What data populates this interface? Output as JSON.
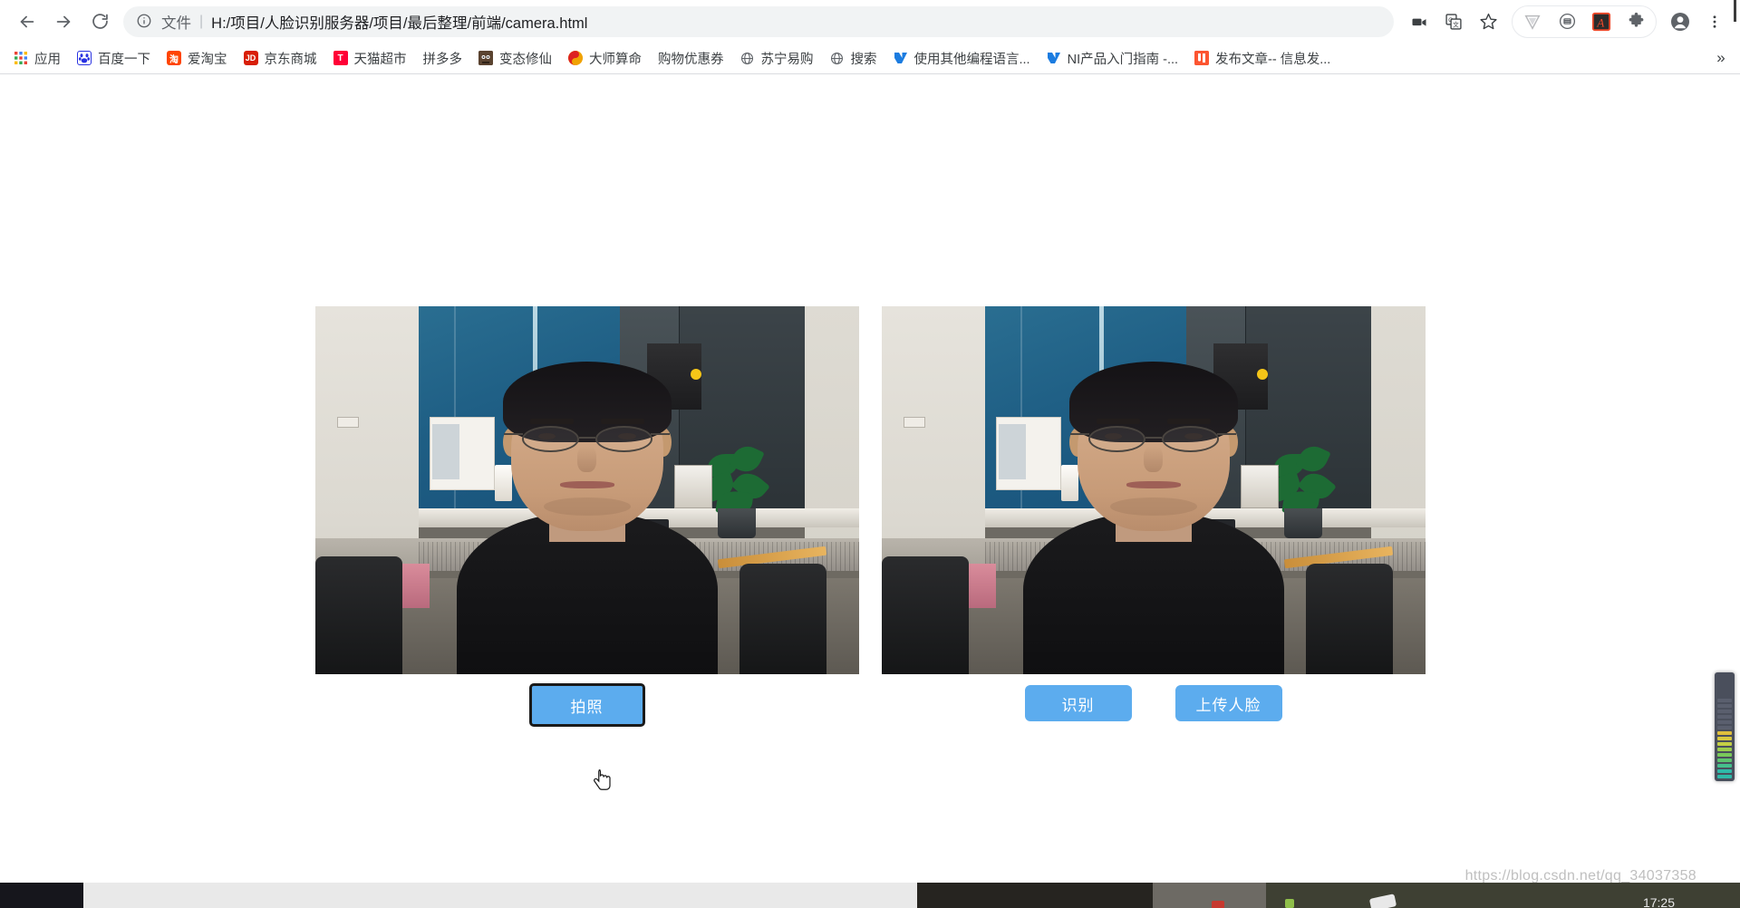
{
  "browser": {
    "nav": {
      "back_label": "Back",
      "forward_label": "Forward",
      "reload_label": "Reload"
    },
    "omnibox": {
      "info_icon": "info-circle-icon",
      "scheme_label": "文件",
      "separator": "|",
      "url": "H:/项目/人脸识别服务器/项目/最后整理/前端/camera.html"
    },
    "toolbar_icons": [
      {
        "name": "video-camera-icon",
        "glyph": "camera"
      },
      {
        "name": "google-translate-icon",
        "glyph": "translate"
      },
      {
        "name": "bookmark-star-icon",
        "glyph": "star"
      }
    ],
    "extension_icons": [
      {
        "name": "vimium-extension-icon",
        "glyph": "V"
      },
      {
        "name": "badge-extension-icon",
        "glyph": "circle"
      },
      {
        "name": "adobe-acrobat-extension-icon",
        "glyph": "A"
      },
      {
        "name": "extensions-puzzle-icon",
        "glyph": "puzzle"
      }
    ],
    "profile_icon": "profile-avatar-icon",
    "menu_icon": "three-dot-menu-icon",
    "bookmarks_overflow_label": "»"
  },
  "bookmarks": [
    {
      "label": "应用",
      "icon": "apps-grid-icon",
      "icon_class": "ic-apps",
      "icon_text": ""
    },
    {
      "label": "百度一下",
      "icon": "baidu-icon",
      "icon_class": "ic-baidu",
      "icon_text": ""
    },
    {
      "label": "爱淘宝",
      "icon": "taobao-icon",
      "icon_class": "ic-taobao",
      "icon_text": "淘"
    },
    {
      "label": "京东商城",
      "icon": "jd-icon",
      "icon_class": "ic-jd",
      "icon_text": "JD"
    },
    {
      "label": "天猫超市",
      "icon": "tmall-icon",
      "icon_class": "ic-tmall",
      "icon_text": "T"
    },
    {
      "label": "拼多多",
      "icon": "pinduoduo-icon",
      "icon_class": "ic-pdd",
      "icon_text": ""
    },
    {
      "label": "变态修仙",
      "icon": "game-avatar-icon",
      "icon_class": "ic-btxx",
      "icon_text": ""
    },
    {
      "label": "大师算命",
      "icon": "taiji-icon",
      "icon_class": "ic-dsm",
      "icon_text": ""
    },
    {
      "label": "购物优惠券",
      "icon": "coupon-icon",
      "icon_class": "ic-gwyhq",
      "icon_text": ""
    },
    {
      "label": "苏宁易购",
      "icon": "globe-icon",
      "icon_class": "ic-globe",
      "icon_text": ""
    },
    {
      "label": "搜索",
      "icon": "globe-icon",
      "icon_class": "ic-globe",
      "icon_text": ""
    },
    {
      "label": "使用其他编程语言...",
      "icon": "ni-icon",
      "icon_class": "ic-ni",
      "icon_text": ""
    },
    {
      "label": "NI产品入门指南 -...",
      "icon": "ni-icon",
      "icon_class": "ic-ni",
      "icon_text": ""
    },
    {
      "label": "发布文章-- 信息发...",
      "icon": "csdn-icon",
      "icon_class": "ic-csdn",
      "icon_text": ""
    }
  ],
  "page": {
    "left_panel": {
      "name": "live-camera-feed",
      "buttons": [
        {
          "label": "拍照",
          "name": "capture-photo-button",
          "style": "focused"
        }
      ]
    },
    "right_panel": {
      "name": "captured-photo-preview",
      "buttons": [
        {
          "label": "识别",
          "name": "recognize-face-button",
          "style": "normal"
        },
        {
          "label": "上传人脸",
          "name": "upload-face-button",
          "style": "normal"
        }
      ]
    },
    "watermark": "https://blog.csdn.net/qq_34037358",
    "accent_color": "#5cacee",
    "cursor": "pointer-hand-cursor"
  },
  "taskbar": {
    "clock": "17:25"
  }
}
